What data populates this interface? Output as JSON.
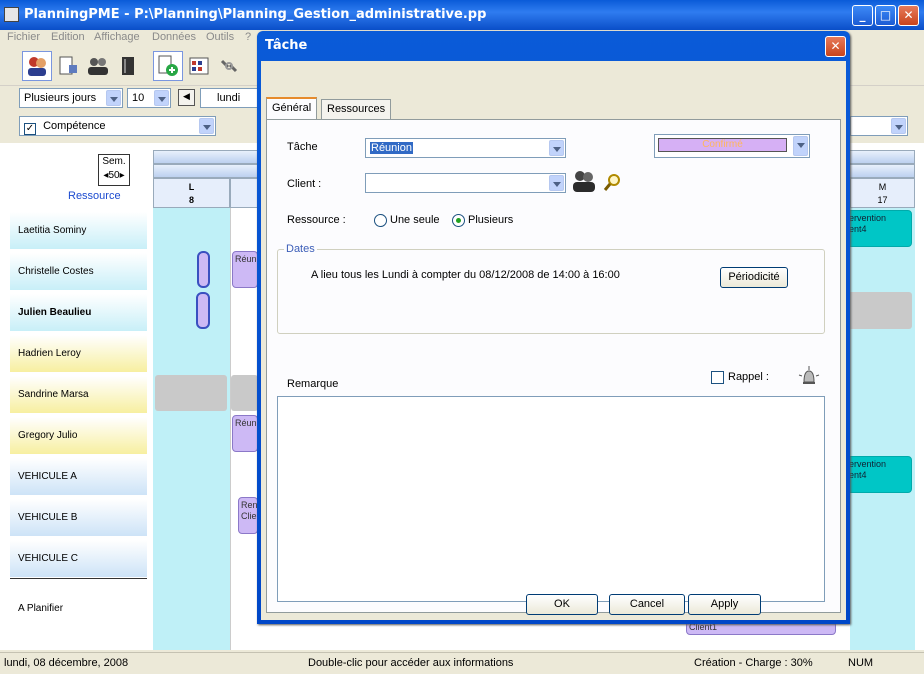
{
  "app": {
    "title": "PlanningPME - P:\\Planning\\Planning_Gestion_administrative.pp",
    "minimize": "_",
    "maximize": "□",
    "close": "✕"
  },
  "menu": [
    "Fichier",
    "Edition",
    "Affichage",
    "Données",
    "Outils",
    "?"
  ],
  "toolbar": {
    "view_mode": "Plusieurs jours",
    "day_count": "10",
    "day_label": "lundi",
    "filter_label": "Compétence"
  },
  "planning": {
    "week_label": "Sem.",
    "week_number": "50",
    "resource_header": "Ressource",
    "day_left": {
      "letter": "L",
      "number": "8"
    },
    "day_right": {
      "letter": "M",
      "number": "17"
    },
    "resources": [
      {
        "name": "Laetitia Sominy",
        "bold": false,
        "style": "cyan"
      },
      {
        "name": "Christelle Costes",
        "bold": false,
        "style": "cyan"
      },
      {
        "name": "Julien Beaulieu",
        "bold": true,
        "style": "cyan"
      },
      {
        "name": "Hadrien Leroy",
        "bold": false,
        "style": "yel"
      },
      {
        "name": "Sandrine Marsa",
        "bold": false,
        "style": "yel"
      },
      {
        "name": "Gregory Julio",
        "bold": false,
        "style": "yel"
      },
      {
        "name": "VEHICULE A",
        "bold": false,
        "style": "blu"
      },
      {
        "name": "VEHICULE B",
        "bold": false,
        "style": "blu"
      },
      {
        "name": "VEHICULE C",
        "bold": false,
        "style": "blu"
      },
      {
        "name": "A Planifier",
        "bold": false,
        "style": "plain"
      }
    ],
    "events": {
      "reunion_1": "Réun",
      "reunion_2": "Réun",
      "rendez_vous_1": "Ren",
      "rendez_vous_2": "Clie",
      "intervention_1a": "ervention",
      "intervention_1b": "ent4",
      "intervention_2a": "ervention",
      "intervention_2b": "ent4",
      "client_bottom": "Client1"
    }
  },
  "status_bar": {
    "date": "lundi, 08 décembre, 2008",
    "hint": "Double-clic pour accéder aux informations",
    "mode": "Création - Charge : 30%",
    "num": "NUM"
  },
  "dialog": {
    "title": "Tâche",
    "tabs": [
      "Général",
      "Ressources"
    ],
    "task_label": "Tâche",
    "task_value": "Réunion",
    "status_value": "Confirmé",
    "client_label": "Client :",
    "client_value": "",
    "resource_label": "Ressource :",
    "resource_options": [
      "Une seule",
      "Plusieurs"
    ],
    "dates_label": "Dates",
    "recurrence_text": "A lieu tous les Lundi à compter du 08/12/2008 de 14:00 à 16:00",
    "periodicity_button": "Périodicité",
    "remark_label": "Remarque",
    "reminder_label": "Rappel :",
    "ok_button": "OK",
    "cancel_button": "Cancel",
    "apply_button": "Apply",
    "colors": {
      "status_fill": "#d6b0f5",
      "status_text": "#ffb65c"
    }
  }
}
